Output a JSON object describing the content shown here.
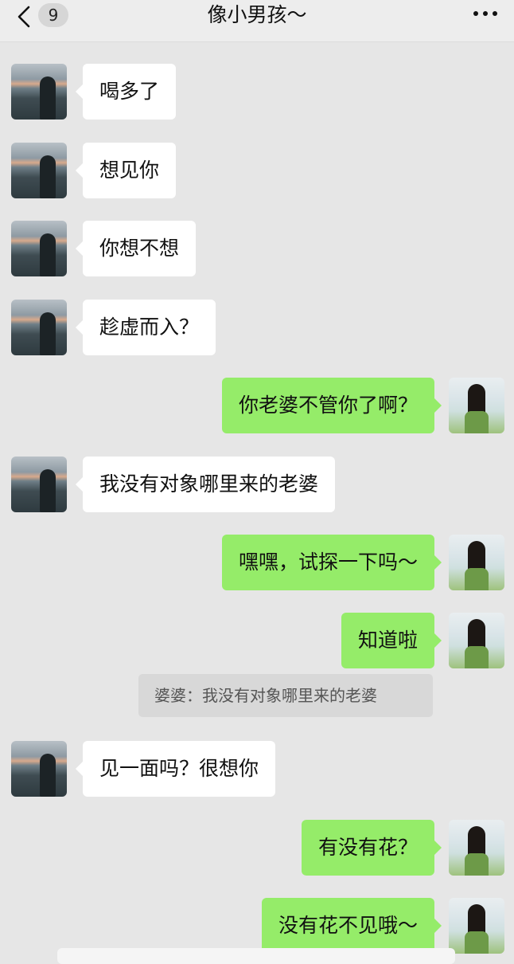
{
  "header": {
    "back_icon": "chevron-left-icon",
    "unread_count": "9",
    "title": "像小男孩～",
    "more_icon": "ellipsis-icon"
  },
  "messages": [
    {
      "side": "left",
      "text": "喝多了"
    },
    {
      "side": "left",
      "text": "想见你"
    },
    {
      "side": "left",
      "text": "你想不想"
    },
    {
      "side": "left",
      "text": "趁虚而入？"
    },
    {
      "side": "right",
      "text": "你老婆不管你了啊？"
    },
    {
      "side": "left",
      "text": "我没有对象哪里来的老婆"
    },
    {
      "side": "right",
      "text": "嘿嘿，试探一下吗～"
    },
    {
      "side": "right",
      "text": "知道啦",
      "quote": "婆婆：我没有对象哪里来的老婆"
    },
    {
      "side": "left",
      "text": "见一面吗？很想你"
    },
    {
      "side": "right",
      "text": "有没有花？"
    },
    {
      "side": "right",
      "text": "没有花不见哦～"
    }
  ],
  "colors": {
    "background": "#e6e6e6",
    "sent_bubble": "#95ec69",
    "received_bubble": "#ffffff"
  }
}
